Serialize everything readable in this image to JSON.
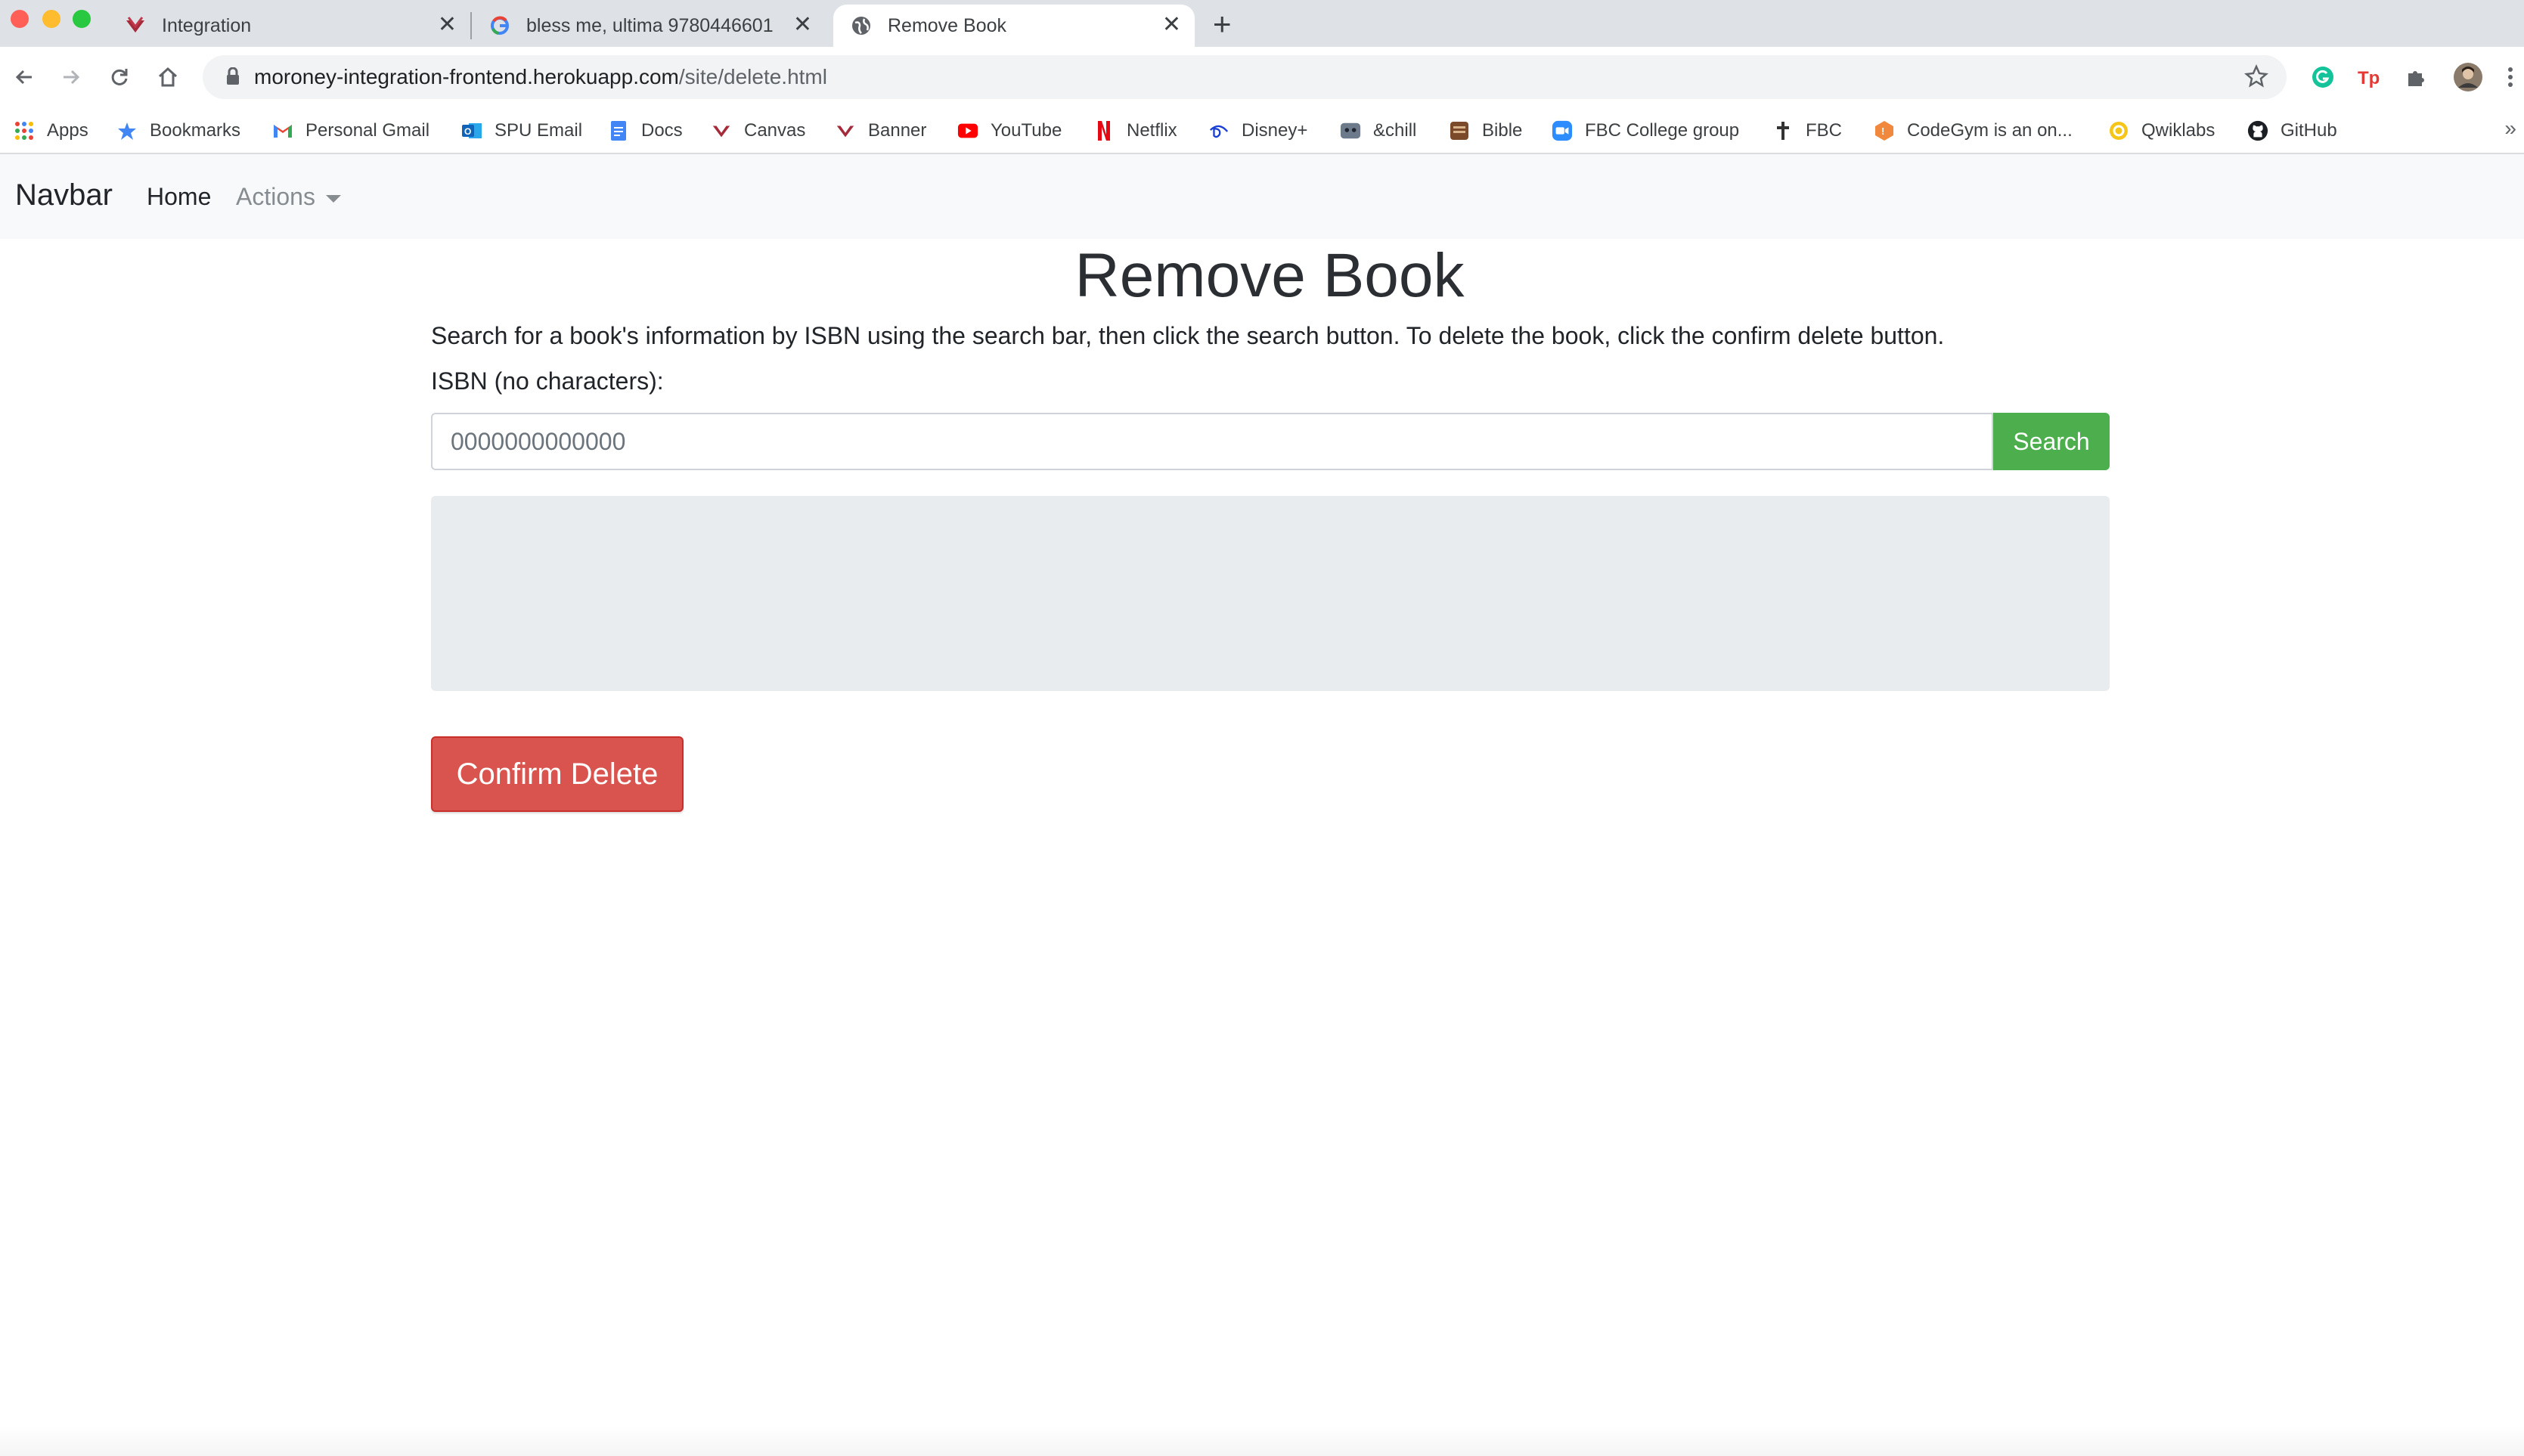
{
  "browser": {
    "tabs": [
      {
        "title": "Integration",
        "icon": "canvas-icon"
      },
      {
        "title": "bless me, ultima 9780446601",
        "icon": "google-icon"
      },
      {
        "title": "Remove Book",
        "icon": "globe-icon"
      }
    ],
    "url_host": "moroney-integration-frontend.herokuapp.com",
    "url_path": "/site/delete.html",
    "bookmarks": [
      "Apps",
      "Bookmarks",
      "Personal Gmail",
      "SPU Email",
      "Docs",
      "Canvas",
      "Banner",
      "YouTube",
      "Netflix",
      "Disney+",
      "&chill",
      "Bible",
      "FBC College group",
      "FBC",
      "CodeGym is an on...",
      "Qwiklabs",
      "GitHub"
    ],
    "bookmarks_overflow": "»"
  },
  "navbar": {
    "brand": "Navbar",
    "home": "Home",
    "actions": "Actions"
  },
  "main": {
    "title": "Remove Book",
    "description": "Search for a book's information by ISBN using the search bar, then click the search button. To delete the book, click the confirm delete button.",
    "isbn_label": "ISBN (no characters):",
    "isbn_placeholder": "0000000000000",
    "search_label": "Search",
    "confirm_delete_label": "Confirm Delete"
  },
  "colors": {
    "search_button": "#4cae4c",
    "delete_button": "#d9534f",
    "result_box": "#e9ecef",
    "navbar_bg": "#f8f9fa"
  }
}
